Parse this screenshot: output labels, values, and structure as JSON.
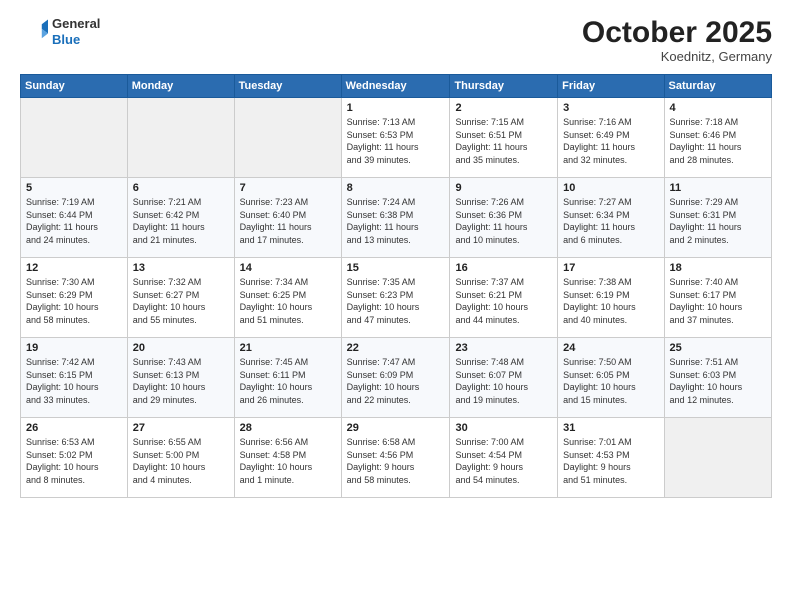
{
  "header": {
    "logo_general": "General",
    "logo_blue": "Blue",
    "month_title": "October 2025",
    "location": "Koednitz, Germany"
  },
  "weekdays": [
    "Sunday",
    "Monday",
    "Tuesday",
    "Wednesday",
    "Thursday",
    "Friday",
    "Saturday"
  ],
  "weeks": [
    [
      {
        "day": "",
        "info": ""
      },
      {
        "day": "",
        "info": ""
      },
      {
        "day": "",
        "info": ""
      },
      {
        "day": "1",
        "info": "Sunrise: 7:13 AM\nSunset: 6:53 PM\nDaylight: 11 hours\nand 39 minutes."
      },
      {
        "day": "2",
        "info": "Sunrise: 7:15 AM\nSunset: 6:51 PM\nDaylight: 11 hours\nand 35 minutes."
      },
      {
        "day": "3",
        "info": "Sunrise: 7:16 AM\nSunset: 6:49 PM\nDaylight: 11 hours\nand 32 minutes."
      },
      {
        "day": "4",
        "info": "Sunrise: 7:18 AM\nSunset: 6:46 PM\nDaylight: 11 hours\nand 28 minutes."
      }
    ],
    [
      {
        "day": "5",
        "info": "Sunrise: 7:19 AM\nSunset: 6:44 PM\nDaylight: 11 hours\nand 24 minutes."
      },
      {
        "day": "6",
        "info": "Sunrise: 7:21 AM\nSunset: 6:42 PM\nDaylight: 11 hours\nand 21 minutes."
      },
      {
        "day": "7",
        "info": "Sunrise: 7:23 AM\nSunset: 6:40 PM\nDaylight: 11 hours\nand 17 minutes."
      },
      {
        "day": "8",
        "info": "Sunrise: 7:24 AM\nSunset: 6:38 PM\nDaylight: 11 hours\nand 13 minutes."
      },
      {
        "day": "9",
        "info": "Sunrise: 7:26 AM\nSunset: 6:36 PM\nDaylight: 11 hours\nand 10 minutes."
      },
      {
        "day": "10",
        "info": "Sunrise: 7:27 AM\nSunset: 6:34 PM\nDaylight: 11 hours\nand 6 minutes."
      },
      {
        "day": "11",
        "info": "Sunrise: 7:29 AM\nSunset: 6:31 PM\nDaylight: 11 hours\nand 2 minutes."
      }
    ],
    [
      {
        "day": "12",
        "info": "Sunrise: 7:30 AM\nSunset: 6:29 PM\nDaylight: 10 hours\nand 58 minutes."
      },
      {
        "day": "13",
        "info": "Sunrise: 7:32 AM\nSunset: 6:27 PM\nDaylight: 10 hours\nand 55 minutes."
      },
      {
        "day": "14",
        "info": "Sunrise: 7:34 AM\nSunset: 6:25 PM\nDaylight: 10 hours\nand 51 minutes."
      },
      {
        "day": "15",
        "info": "Sunrise: 7:35 AM\nSunset: 6:23 PM\nDaylight: 10 hours\nand 47 minutes."
      },
      {
        "day": "16",
        "info": "Sunrise: 7:37 AM\nSunset: 6:21 PM\nDaylight: 10 hours\nand 44 minutes."
      },
      {
        "day": "17",
        "info": "Sunrise: 7:38 AM\nSunset: 6:19 PM\nDaylight: 10 hours\nand 40 minutes."
      },
      {
        "day": "18",
        "info": "Sunrise: 7:40 AM\nSunset: 6:17 PM\nDaylight: 10 hours\nand 37 minutes."
      }
    ],
    [
      {
        "day": "19",
        "info": "Sunrise: 7:42 AM\nSunset: 6:15 PM\nDaylight: 10 hours\nand 33 minutes."
      },
      {
        "day": "20",
        "info": "Sunrise: 7:43 AM\nSunset: 6:13 PM\nDaylight: 10 hours\nand 29 minutes."
      },
      {
        "day": "21",
        "info": "Sunrise: 7:45 AM\nSunset: 6:11 PM\nDaylight: 10 hours\nand 26 minutes."
      },
      {
        "day": "22",
        "info": "Sunrise: 7:47 AM\nSunset: 6:09 PM\nDaylight: 10 hours\nand 22 minutes."
      },
      {
        "day": "23",
        "info": "Sunrise: 7:48 AM\nSunset: 6:07 PM\nDaylight: 10 hours\nand 19 minutes."
      },
      {
        "day": "24",
        "info": "Sunrise: 7:50 AM\nSunset: 6:05 PM\nDaylight: 10 hours\nand 15 minutes."
      },
      {
        "day": "25",
        "info": "Sunrise: 7:51 AM\nSunset: 6:03 PM\nDaylight: 10 hours\nand 12 minutes."
      }
    ],
    [
      {
        "day": "26",
        "info": "Sunrise: 6:53 AM\nSunset: 5:02 PM\nDaylight: 10 hours\nand 8 minutes."
      },
      {
        "day": "27",
        "info": "Sunrise: 6:55 AM\nSunset: 5:00 PM\nDaylight: 10 hours\nand 4 minutes."
      },
      {
        "day": "28",
        "info": "Sunrise: 6:56 AM\nSunset: 4:58 PM\nDaylight: 10 hours\nand 1 minute."
      },
      {
        "day": "29",
        "info": "Sunrise: 6:58 AM\nSunset: 4:56 PM\nDaylight: 9 hours\nand 58 minutes."
      },
      {
        "day": "30",
        "info": "Sunrise: 7:00 AM\nSunset: 4:54 PM\nDaylight: 9 hours\nand 54 minutes."
      },
      {
        "day": "31",
        "info": "Sunrise: 7:01 AM\nSunset: 4:53 PM\nDaylight: 9 hours\nand 51 minutes."
      },
      {
        "day": "",
        "info": ""
      }
    ]
  ]
}
